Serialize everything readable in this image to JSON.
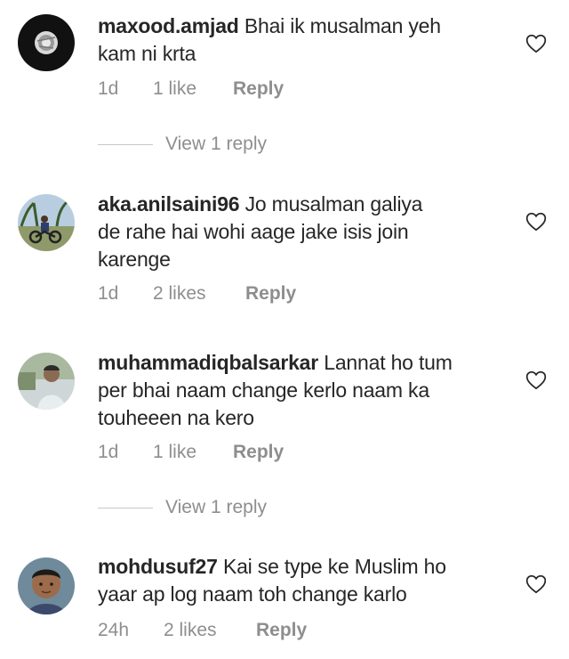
{
  "comments": [
    {
      "username": "maxood.amjad",
      "text": "Bhai ik musalman yeh kam ni krta",
      "line1": "Bhai ik musalman yeh",
      "line2": "kam ni krta",
      "line3": "",
      "age": "1d",
      "likes": "1 like",
      "reply": "Reply",
      "view_replies": "View 1 reply",
      "like_icon": "heart-outline-icon"
    },
    {
      "username": "aka.anilsaini96",
      "text": "Jo musalman galiya de rahe hai wohi aage jake isis join karenge",
      "line1": "Jo musalman galiya",
      "line2": "de rahe hai wohi aage jake isis join",
      "line3": "karenge",
      "age": "1d",
      "likes": "2 likes",
      "reply": "Reply",
      "like_icon": "heart-outline-icon"
    },
    {
      "username": "muhammadiqbalsarkar",
      "text": "Lannat ho tum per bhai naam change kerlo naam ka touheeen na kero",
      "line1": "Lannat ho tum",
      "line2": "per bhai naam change kerlo naam ka",
      "line3": "touheeen na kero",
      "age": "1d",
      "likes": "1 like",
      "reply": "Reply",
      "view_replies": "View 1 reply",
      "like_icon": "heart-outline-icon"
    },
    {
      "username": "mohdusuf27",
      "text": "Kai se type ke Muslim ho yaar ap log naam toh change karlo",
      "line1": "Kai se type ke Muslim ho",
      "line2": "yaar ap log naam toh change karlo",
      "line3": "",
      "age": "24h",
      "likes": "2 likes",
      "reply": "Reply",
      "like_icon": "heart-outline-icon"
    }
  ],
  "colors": {
    "text": "#262626",
    "secondary": "#8e8e8e",
    "divider": "#c7c7c7",
    "background": "#ffffff"
  }
}
